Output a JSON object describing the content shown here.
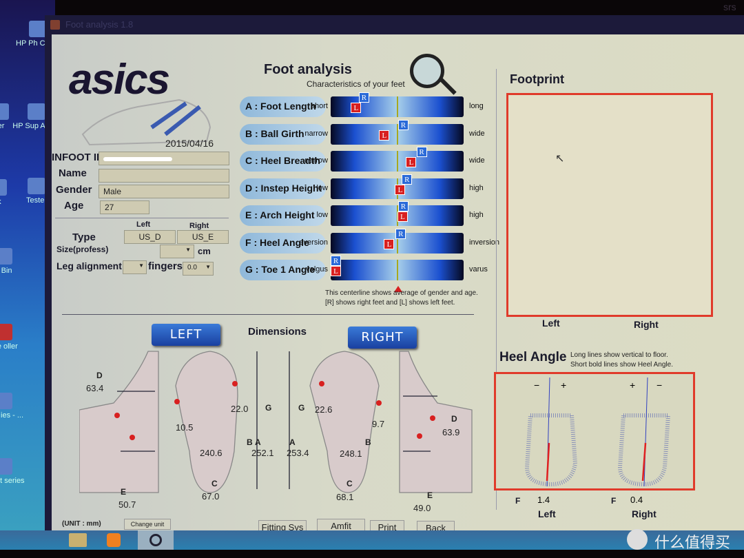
{
  "desktop": {
    "icons": [
      {
        "label": "HP Ph Creati"
      },
      {
        "label": "ter"
      },
      {
        "label": "HP Sup Assist"
      },
      {
        "label": "rk"
      },
      {
        "label": "Tester"
      },
      {
        "label": "e Bin"
      },
      {
        "label": "ase oller"
      },
      {
        "label": "p for ies - ..."
      },
      {
        "label": "eskjet series"
      }
    ],
    "corner_text": "srs"
  },
  "window": {
    "title": "Foot analysis 1.8"
  },
  "brand": {
    "logo": "asics",
    "date": "2015/04/16"
  },
  "profile": {
    "infoot_id_label": "INFOOT ID",
    "infoot_id": "",
    "name_label": "Name",
    "name": "",
    "gender_label": "Gender",
    "gender": "Male",
    "age_label": "Age",
    "age": "27",
    "left_label": "Left",
    "right_label": "Right",
    "type_label": "Type",
    "type_left": "US_D",
    "type_right": "US_E",
    "size_label": "Size(profess)",
    "size_value": "",
    "size_unit": "cm",
    "leg_label": "Leg alignment",
    "leg_value": "",
    "fingers_label": "fingers",
    "fingers_value": "0.0"
  },
  "analysis": {
    "title": "Foot analysis",
    "subtitle": "Characteristics of your feet",
    "marker_r": "R",
    "marker_l": "L",
    "rows": [
      {
        "label": "A : Foot Length",
        "low": "short",
        "high": "long",
        "right": 0.23,
        "left": 0.21
      },
      {
        "label": "B : Ball Girth",
        "low": "narrow",
        "high": "wide",
        "right": 0.55,
        "left": 0.44
      },
      {
        "label": "C : Heel Breadth",
        "low": "narrow",
        "high": "wide",
        "right": 0.7,
        "left": 0.66
      },
      {
        "label": "D : Instep Height",
        "low": "low",
        "high": "high",
        "right": 0.58,
        "left": 0.57
      },
      {
        "label": "E : Arch Height",
        "low": "low",
        "high": "high",
        "right": 0.55,
        "left": 0.59
      },
      {
        "label": "F : Heel Angle",
        "low": "eversion",
        "high": "inversion",
        "right": 0.53,
        "left": 0.48
      },
      {
        "label": "G : Toe 1 Angle",
        "low": "valgus",
        "high": "varus",
        "right": 0.0,
        "left": 0.0
      }
    ],
    "note1": "This centerline shows average of gender and age.",
    "note2": "[R]  shows right feet and [L] shows left feet."
  },
  "dimensions": {
    "title": "Dimensions",
    "left_button": "LEFT",
    "right_button": "RIGHT",
    "left": {
      "D": "63.4",
      "E": "50.7",
      "toe5": "10.5",
      "G": "22.0",
      "B": "240.6",
      "A": "252.1",
      "C": "67.0"
    },
    "right": {
      "D": "63.9",
      "E": "49.0",
      "toe5": "9.7",
      "G": "22.6",
      "B": "248.1",
      "A": "253.4",
      "C": "68.1"
    },
    "letters": {
      "A": "A",
      "B": "B",
      "C": "C",
      "D": "D",
      "E": "E",
      "G": "G"
    },
    "unit": "(UNIT : mm)",
    "change_unit": "Change unit"
  },
  "buttons": {
    "fitting": "Fitting Sys",
    "amfit": "Amfit",
    "print": "Print",
    "back": "Back"
  },
  "footprint": {
    "title": "Footprint",
    "left": "Left",
    "right": "Right"
  },
  "heel": {
    "title": "Heel Angle",
    "note1": "Long lines show vertical to floor.",
    "note2": "Short bold lines show Heel Angle.",
    "minus": "−",
    "plus": "+",
    "f_label": "F",
    "left_value": "1.4",
    "right_value": "0.4",
    "left": "Left",
    "right": "Right"
  },
  "watermark": "什么值得买",
  "colors": {
    "accent_red": "#d82020",
    "accent_blue": "#2a6ad8",
    "frame_red": "#e03a2a"
  }
}
